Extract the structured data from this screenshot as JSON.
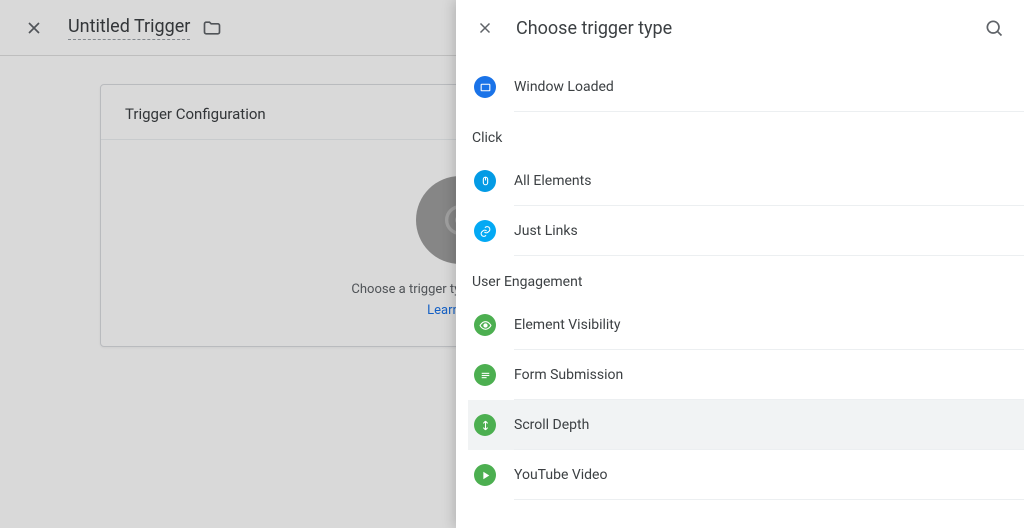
{
  "page": {
    "title": "Untitled Trigger",
    "card_title": "Trigger Configuration",
    "helper_text": "Choose a trigger type to begin setup…",
    "learn_more": "Learn More"
  },
  "panel": {
    "title": "Choose trigger type",
    "items": [
      {
        "label": "Window Loaded",
        "icon": "window-loaded-icon",
        "color": "c-blue1",
        "group": null
      },
      {
        "label": "All Elements",
        "icon": "mouse-icon",
        "color": "c-blue2",
        "group": "Click"
      },
      {
        "label": "Just Links",
        "icon": "link-icon",
        "color": "c-blue3",
        "group": null
      },
      {
        "label": "Element Visibility",
        "icon": "eye-icon",
        "color": "c-green",
        "group": "User Engagement"
      },
      {
        "label": "Form Submission",
        "icon": "form-icon",
        "color": "c-green",
        "group": null
      },
      {
        "label": "Scroll Depth",
        "icon": "scroll-icon",
        "color": "c-green",
        "group": null,
        "highlighted": true
      },
      {
        "label": "YouTube Video",
        "icon": "play-icon",
        "color": "c-green",
        "group": null
      }
    ],
    "group_click": "Click",
    "group_engagement": "User Engagement"
  }
}
